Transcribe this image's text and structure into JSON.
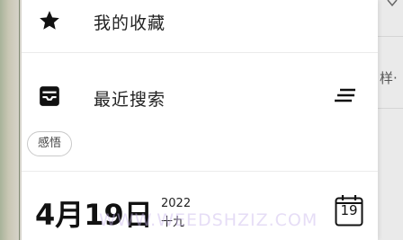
{
  "drawer": {
    "favorites_label": "我的收藏",
    "recent_search_label": "最近搜索",
    "recent_chips": [
      "感悟"
    ]
  },
  "date": {
    "big": "4月19日",
    "year": "2022",
    "lunar": "十九",
    "calendar_day": "19"
  },
  "background": {
    "text": "样·"
  },
  "watermark": "WWW.WEEDSHZIZ.COM",
  "icons": {
    "favorites": "star-icon",
    "recent_search": "inbox-tray-icon",
    "sort": "sort-lines-icon",
    "calendar": "calendar-icon"
  }
}
